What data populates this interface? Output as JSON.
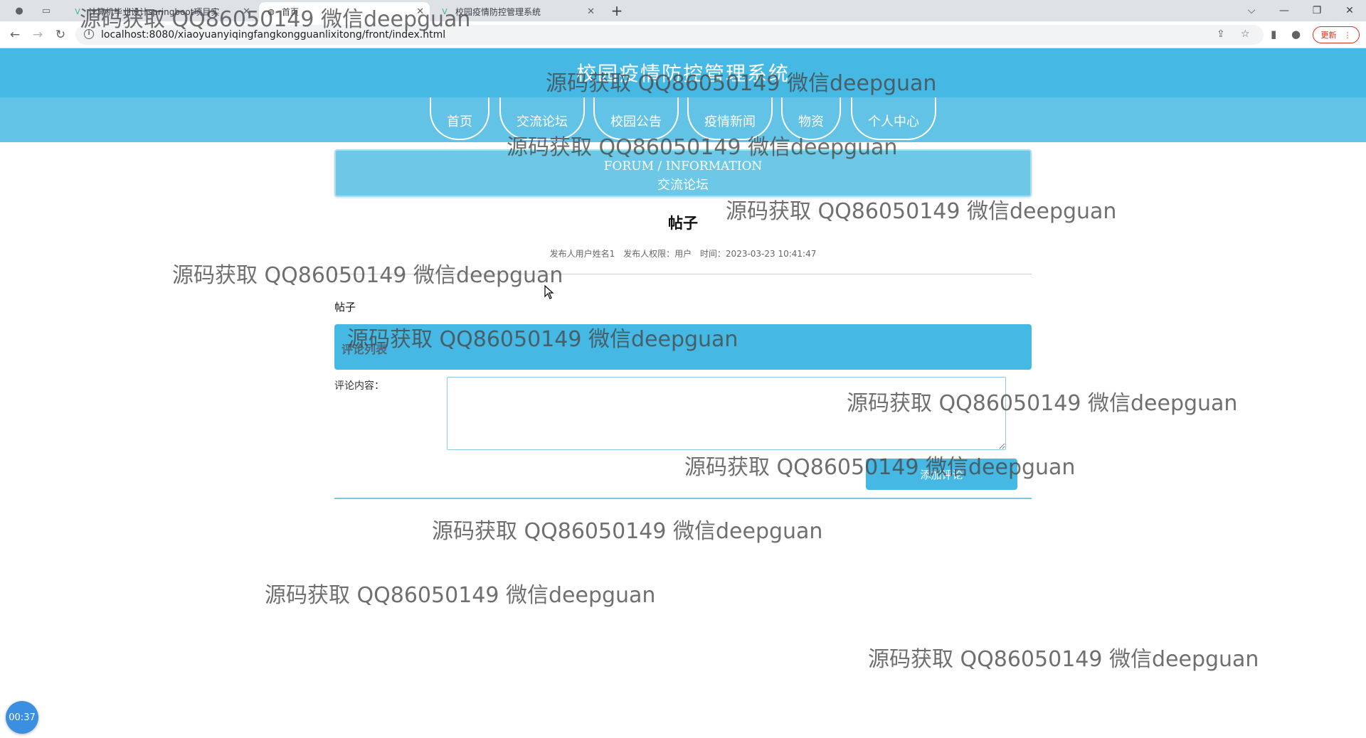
{
  "browser": {
    "tabs": [
      {
        "title": "计算机毕业设计springboot项目实",
        "icon": "vue-logo-icon"
      },
      {
        "title": "首页",
        "icon": "globe-icon"
      },
      {
        "title": "校园疫情防控管理系统",
        "icon": "vue-logo-icon"
      }
    ],
    "url": "localhost:8080/xiaoyuanyiqingfangkongguanlixitong/front/index.html",
    "update_label": "更新"
  },
  "site": {
    "title": "校园疫情防控管理系统",
    "nav": [
      "首页",
      "交流论坛",
      "校园公告",
      "疫情新闻",
      "物资",
      "个人中心"
    ]
  },
  "banner": {
    "en": "FORUM / INFORMATION",
    "cn": "交流论坛"
  },
  "post": {
    "title": "帖子",
    "author_label": "发布人用户姓名1",
    "role_label": "发布人权限：用户",
    "time_label": "时间：2023-03-23 10:41:47",
    "content": "帖子"
  },
  "comments": {
    "header": "评论列表",
    "input_label": "评论内容：",
    "input_value": "",
    "submit_label": "添加评论"
  },
  "timer": "00:37",
  "watermark": "源码获取 QQ86050149 微信deepguan",
  "colors": {
    "header_blue": "#45b8e4",
    "nav_blue": "#63c3e6",
    "banner_blue": "#6cc8e6"
  }
}
